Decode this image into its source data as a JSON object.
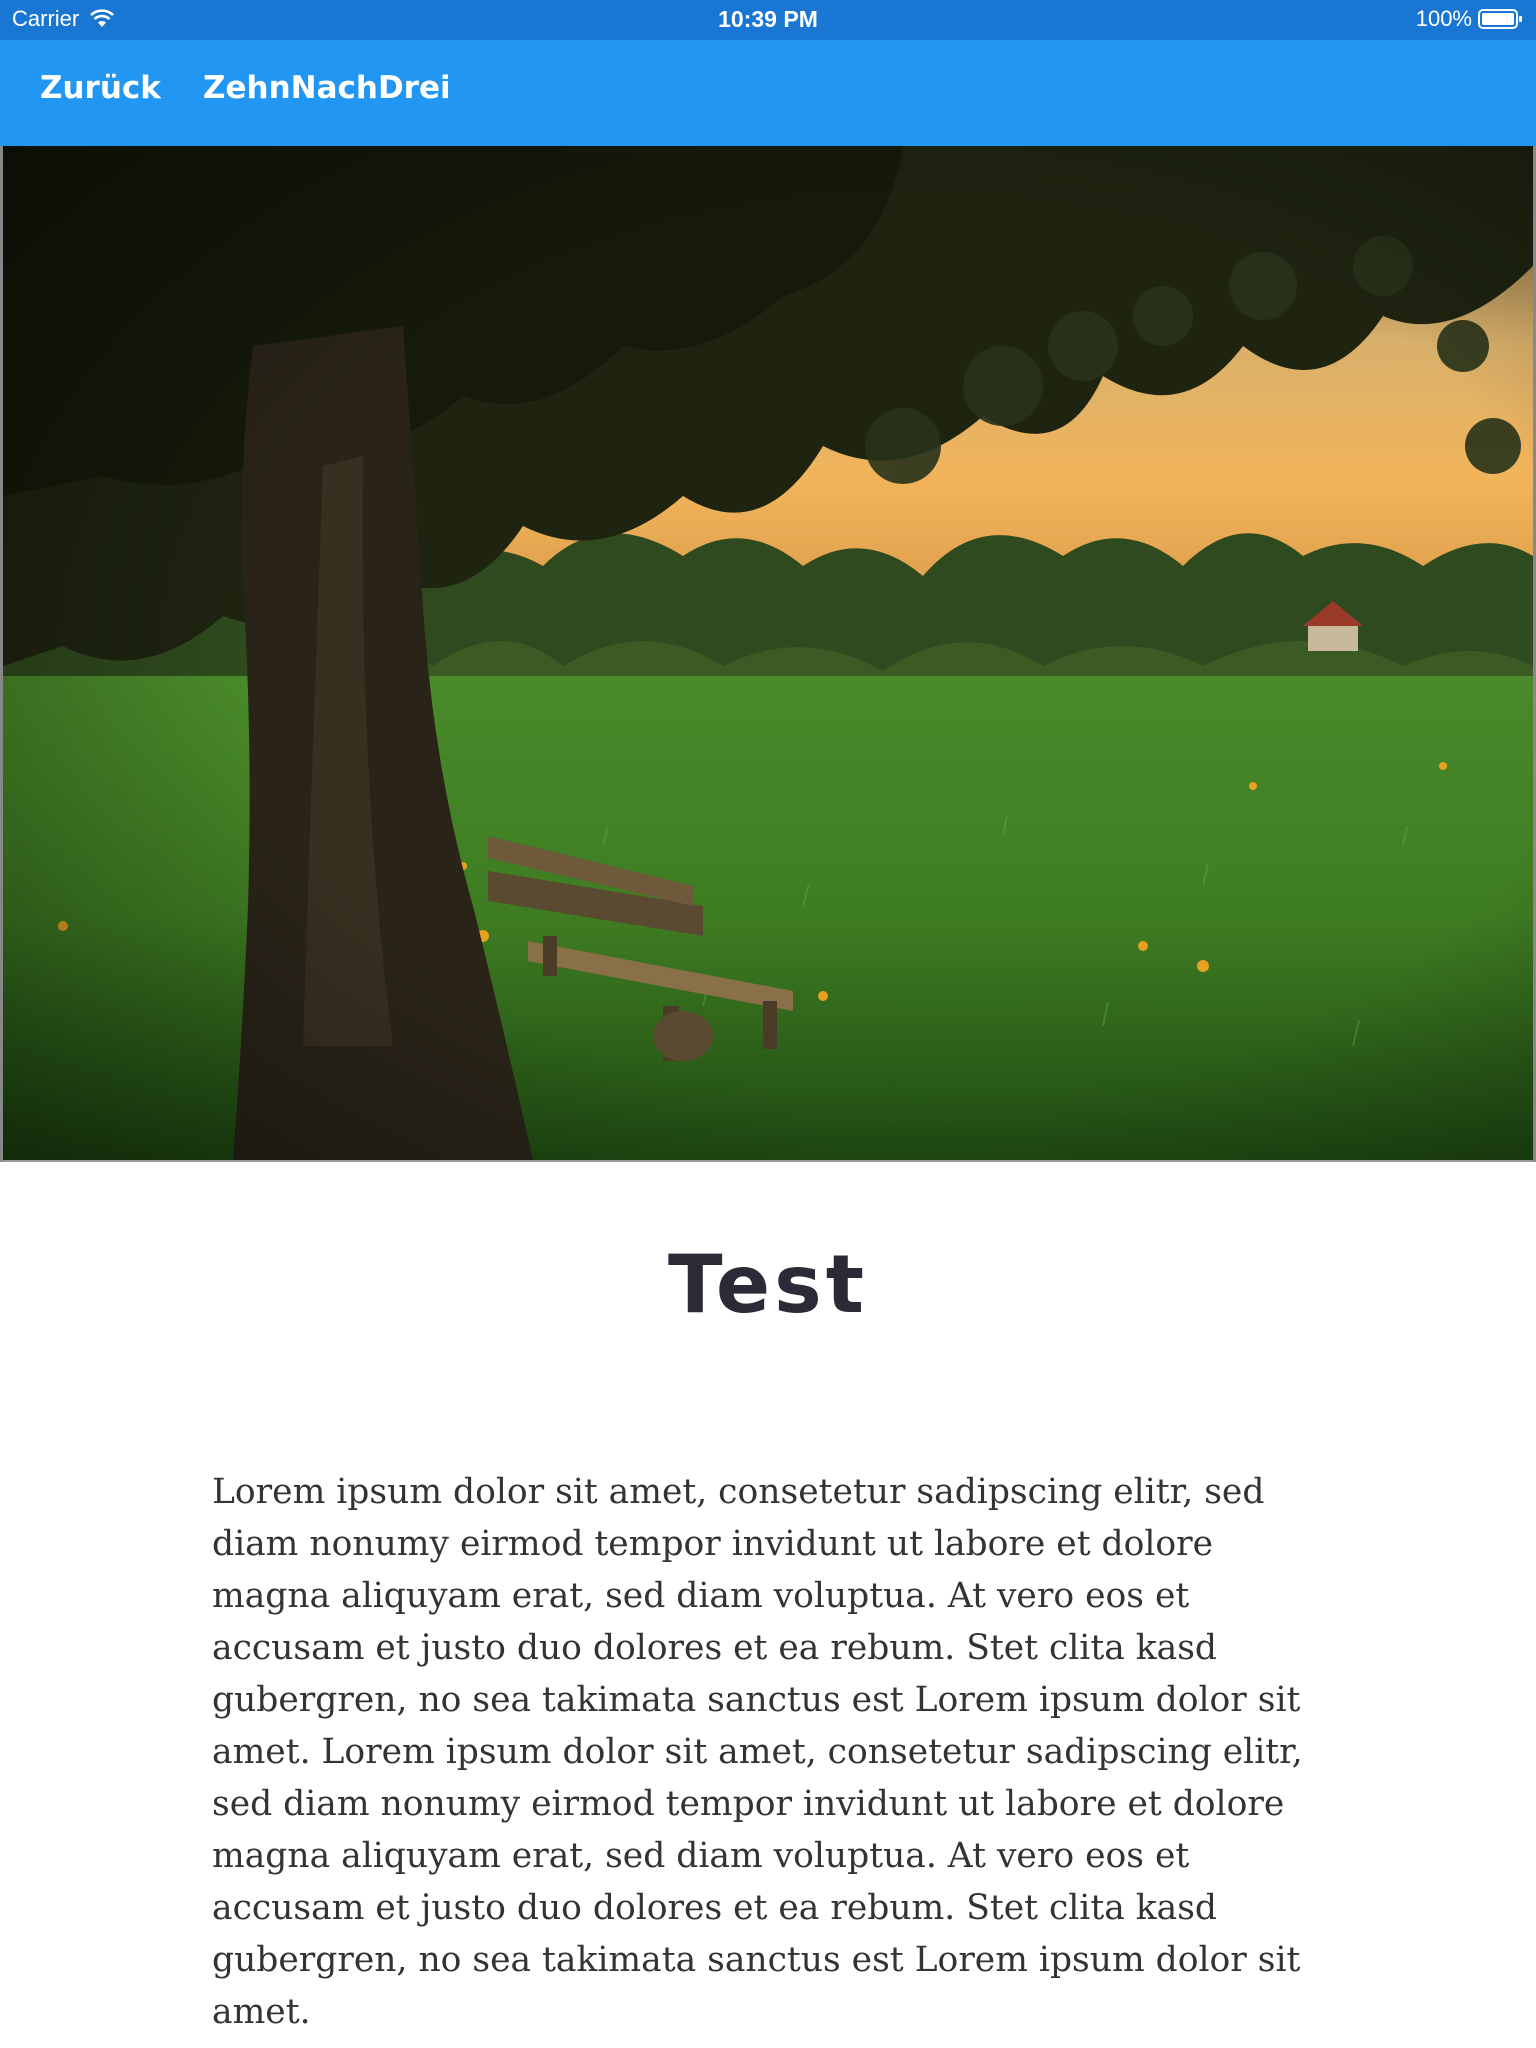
{
  "status_bar": {
    "carrier": "Carrier",
    "wifi_icon": "wifi-icon",
    "time": "10:39 PM",
    "battery_percent": "100%",
    "battery_icon": "battery-icon",
    "battery_level": 1.0
  },
  "nav_bar": {
    "back_label": "Zurück",
    "title": "ZehnNachDrei",
    "color": "#2196F3"
  },
  "hero_image": {
    "subject": "tree-bench-meadow-sunset"
  },
  "article": {
    "title": "Test",
    "body": "Lorem ipsum dolor sit amet, consetetur sadipscing elitr, sed diam nonumy eirmod tempor invidunt ut labore et dolore magna aliquyam erat, sed diam voluptua. At vero eos et accusam et justo duo dolores et ea rebum. Stet clita kasd gubergren, no sea takimata sanctus est Lorem ipsum dolor sit amet. Lorem ipsum dolor sit amet, consetetur sadipscing elitr, sed diam nonumy eirmod tempor invidunt ut labore et dolore magna aliquyam erat, sed diam voluptua. At vero eos et accusam et justo duo dolores et ea rebum. Stet clita kasd gubergren, no sea takimata sanctus est Lorem ipsum dolor sit amet."
  }
}
